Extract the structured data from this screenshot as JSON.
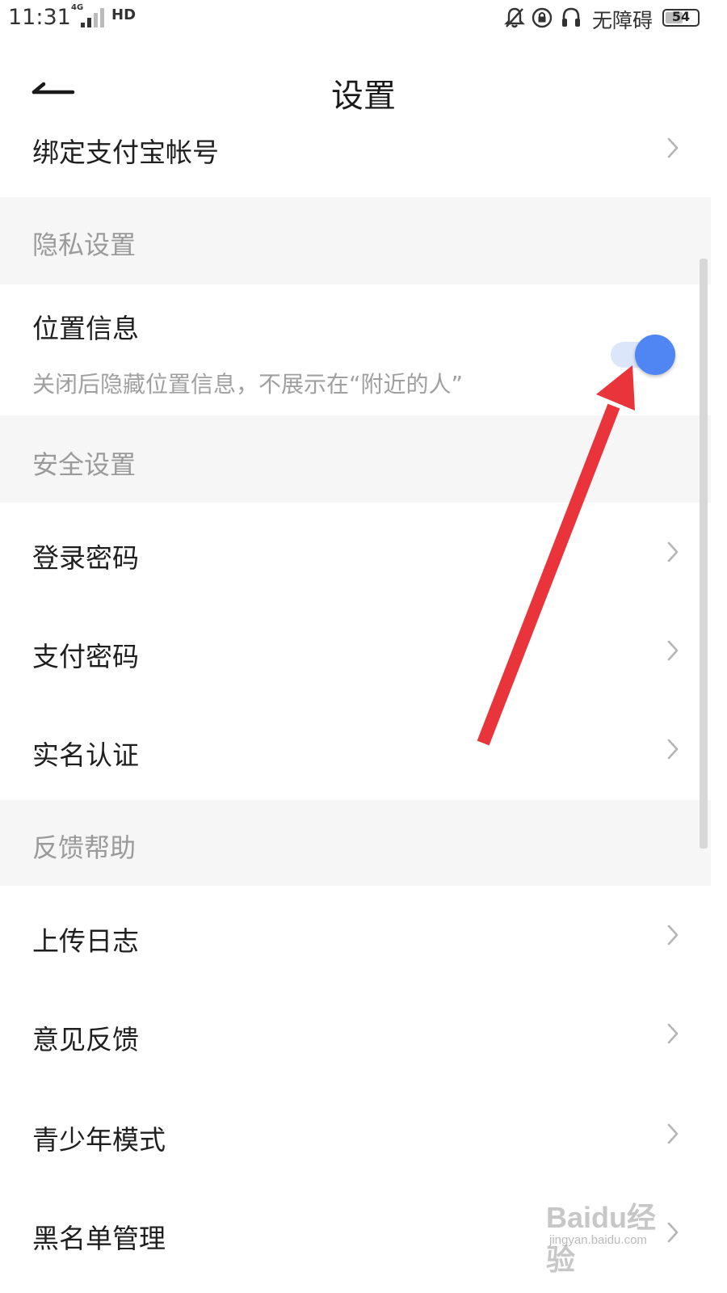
{
  "status_bar": {
    "time": "11:31",
    "network": "4G",
    "hd": "HD",
    "accessibility": "无障碍",
    "battery": "54",
    "battery_percent": 54
  },
  "header": {
    "title": "设置"
  },
  "rows": {
    "alipay": "绑定支付宝帐号",
    "location": "位置信息",
    "location_desc": "关闭后隐藏位置信息，不展示在“附近的人”",
    "login_password": "登录密码",
    "pay_password": "支付密码",
    "real_name": "实名认证",
    "upload_log": "上传日志",
    "feedback": "意见反馈",
    "youth_mode": "青少年模式",
    "blacklist": "黑名单管理"
  },
  "sections": {
    "privacy": "隐私设置",
    "security": "安全设置",
    "help": "反馈帮助"
  },
  "location_toggle": {
    "on": true,
    "color": "#4f86f3"
  },
  "annotation": {
    "color": "#e8343a"
  },
  "watermark": {
    "brand": "Baidu经验",
    "site": "jingyan.baidu.com"
  }
}
